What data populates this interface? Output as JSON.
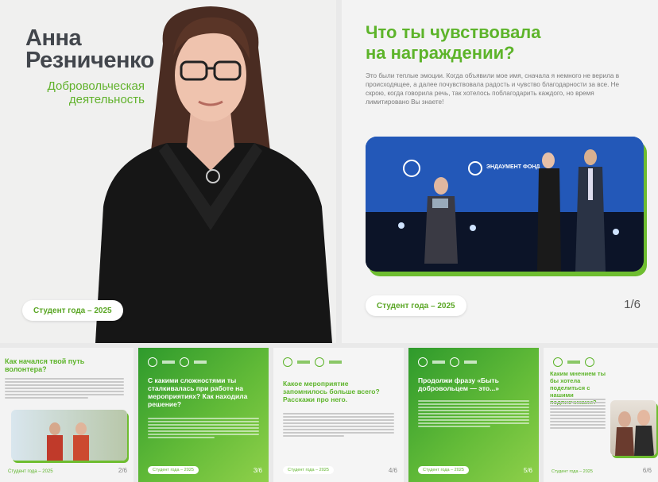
{
  "slide1": {
    "name_line1": "Анна",
    "name_line2": "Резниченко",
    "activity_line1": "Добровольческая",
    "activity_line2": "деятельность",
    "badge": "Студент года – 2025"
  },
  "slide2": {
    "title_line1": "Что ты чувствовала",
    "title_line2": "на награждении?",
    "body": "Это были теплые эмоции. Когда объявили мое имя, сначала я немного не верила в происходящее, а далее почувствовала радость и чувство благодарности за все. Не скрою, когда говорила речь, так хотелось поблагодарить каждого, но время лимитировано Вы знаете!",
    "badge": "Студент года – 2025",
    "counter": "1/6",
    "stage_sign": "ЭНДАУМЕНТ ФОНД"
  },
  "thumbs": [
    {
      "title": "Как начался твой путь волонтера?",
      "counter": "2/6",
      "badge": "Студент года – 2025"
    },
    {
      "title": "С какими сложностями ты сталкивалась при работе на мероприятиях? Как находила решение?",
      "counter": "3/6",
      "badge": "Студент года – 2025"
    },
    {
      "title": "Какое мероприятие запомнилось больше всего? Расскажи про него.",
      "counter": "4/6",
      "badge": "Студент года – 2025"
    },
    {
      "title": "Продолжи фразу «Быть добровольцем — это...»",
      "counter": "5/6",
      "badge": "Студент года – 2025"
    },
    {
      "title": "Каким мнением ты бы хотела поделиться с нашими подписчиками?",
      "counter": "6/6",
      "badge": "Студент года – 2025"
    }
  ],
  "colors": {
    "accent": "#5db42a",
    "dark_text": "#42464c"
  }
}
